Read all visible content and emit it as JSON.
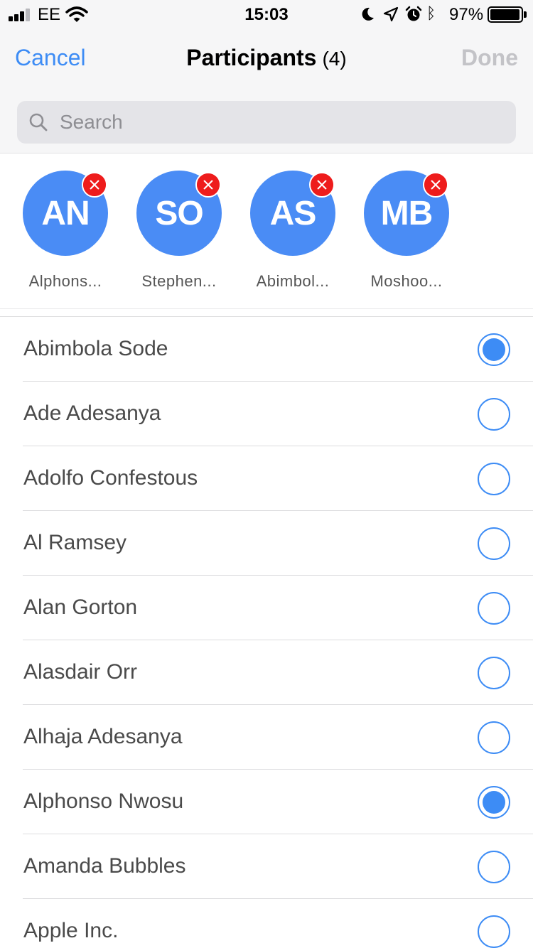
{
  "status_bar": {
    "carrier": "EE",
    "time": "15:03",
    "battery": "97%",
    "battery_level": 0.97,
    "signal_bars": 3,
    "icons": [
      "signal-icon",
      "wifi-icon",
      "moon-icon",
      "location-icon",
      "alarm-icon",
      "bluetooth-icon",
      "battery-icon"
    ]
  },
  "nav": {
    "cancel": "Cancel",
    "title": "Participants",
    "count": "(4)",
    "done": "Done"
  },
  "search": {
    "placeholder": "Search",
    "value": ""
  },
  "selected": [
    {
      "initials": "AN",
      "name": "Alphons..."
    },
    {
      "initials": "SO",
      "name": "Stephen..."
    },
    {
      "initials": "AS",
      "name": "Abimbol..."
    },
    {
      "initials": "MB",
      "name": "Moshoo..."
    }
  ],
  "contacts": [
    {
      "name": "Abimbola Sode",
      "selected": true
    },
    {
      "name": "Ade Adesanya",
      "selected": false
    },
    {
      "name": "Adolfo Confestous",
      "selected": false
    },
    {
      "name": "Al Ramsey",
      "selected": false
    },
    {
      "name": "Alan Gorton",
      "selected": false
    },
    {
      "name": "Alasdair Orr",
      "selected": false
    },
    {
      "name": "Alhaja Adesanya",
      "selected": false
    },
    {
      "name": "Alphonso Nwosu",
      "selected": true
    },
    {
      "name": "Amanda Bubbles",
      "selected": false
    },
    {
      "name": "Apple Inc.",
      "selected": false
    }
  ],
  "colors": {
    "accent": "#3d8cf5",
    "avatar": "#4a8cf5",
    "remove": "#ee1c1c",
    "disabled": "#c3c3c7"
  }
}
